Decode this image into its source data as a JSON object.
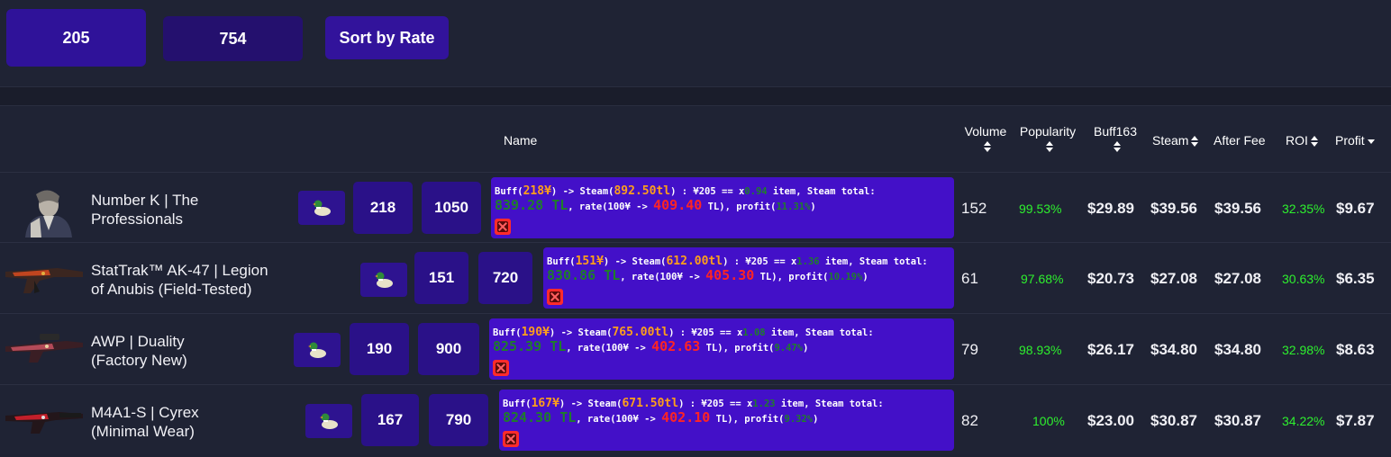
{
  "toolbar": {
    "value1": "205",
    "value2": "754",
    "sort_label": "Sort by Rate"
  },
  "table": {
    "headers": {
      "name": "Name",
      "volume": "Volume",
      "popularity": "Popularity",
      "buff": "Buff163",
      "steam": "Steam",
      "after_fee": "After Fee",
      "roi": "ROI",
      "profit": "Profit"
    },
    "rows": [
      {
        "name_line1": "Number K | The",
        "name_line2": "Professionals",
        "buff_val": "218",
        "steam_val": "1050",
        "info": {
          "buff": "218¥",
          "steam": "892.50tl",
          "rate": "¥205",
          "mult": "0.94",
          "total": "839.28 TL",
          "rate100": "409.40",
          "profit": "11.31%"
        },
        "volume": "152",
        "popularity": "99.53%",
        "buff163": "$29.89",
        "steam_price": "$39.56",
        "after_fee": "$39.56",
        "roi": "32.35%",
        "profit": "$9.67"
      },
      {
        "name_line1": "StatTrak™ AK-47 | Legion",
        "name_line2": "of Anubis (Field-Tested)",
        "buff_val": "151",
        "steam_val": "720",
        "info": {
          "buff": "151¥",
          "steam": "612.00tl",
          "rate": "¥205",
          "mult": "1.36",
          "total": "830.86 TL",
          "rate100": "405.30",
          "profit": "10.19%"
        },
        "volume": "61",
        "popularity": "97.68%",
        "buff163": "$20.73",
        "steam_price": "$27.08",
        "after_fee": "$27.08",
        "roi": "30.63%",
        "profit": "$6.35"
      },
      {
        "name_line1": "AWP | Duality",
        "name_line2": "(Factory New)",
        "buff_val": "190",
        "steam_val": "900",
        "info": {
          "buff": "190¥",
          "steam": "765.00tl",
          "rate": "¥205",
          "mult": "1.08",
          "total": "825.39 TL",
          "rate100": "402.63",
          "profit": "9.47%"
        },
        "volume": "79",
        "popularity": "98.93%",
        "buff163": "$26.17",
        "steam_price": "$34.80",
        "after_fee": "$34.80",
        "roi": "32.98%",
        "profit": "$8.63"
      },
      {
        "name_line1": "M4A1-S | Cyrex",
        "name_line2": "(Minimal Wear)",
        "buff_val": "167",
        "steam_val": "790",
        "info": {
          "buff": "167¥",
          "steam": "671.50tl",
          "rate": "¥205",
          "mult": "1.23",
          "total": "824.30 TL",
          "rate100": "402.10",
          "profit": "9.32%"
        },
        "volume": "82",
        "popularity": "100%",
        "buff163": "$23.00",
        "steam_price": "$30.87",
        "after_fee": "$30.87",
        "roi": "34.22%",
        "profit": "$7.87"
      }
    ]
  },
  "colors": {
    "accent": "#2a1188",
    "info_bg": "#4310c8",
    "positive": "#2ef02e",
    "buff_orange": "#ff9f1a",
    "rate_red": "#ff2424"
  }
}
